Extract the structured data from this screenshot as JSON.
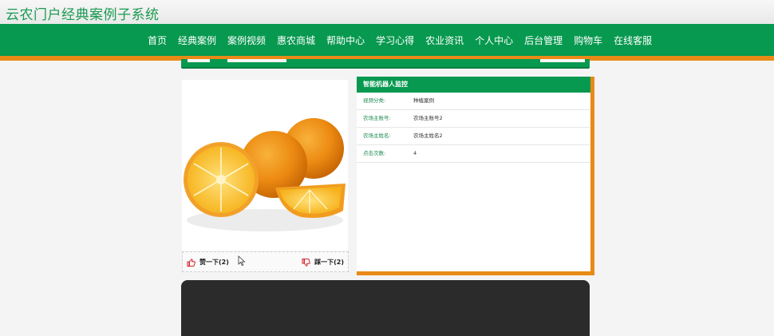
{
  "site": {
    "title": "云农门户经典案例子系统"
  },
  "nav": {
    "items": [
      "首页",
      "经典案例",
      "案例视频",
      "惠农商城",
      "帮助中心",
      "学习心得",
      "农业资讯",
      "个人中心",
      "后台管理",
      "购物车",
      "在线客服"
    ]
  },
  "detail": {
    "title": "智能机器人监控",
    "rows": [
      {
        "label": "视频分类:",
        "value": "种植案例"
      },
      {
        "label": "农场主账号:",
        "value": "农场主账号2"
      },
      {
        "label": "农场主姓名:",
        "value": "农场主姓名2"
      },
      {
        "label": "点击次数:",
        "value": "4"
      }
    ]
  },
  "votes": {
    "up_label": "赞一下(2)",
    "down_label": "踩一下(2)"
  },
  "colors": {
    "brand_green": "#07994f",
    "accent_orange": "#e98a16",
    "title_green": "#1a9a50"
  }
}
